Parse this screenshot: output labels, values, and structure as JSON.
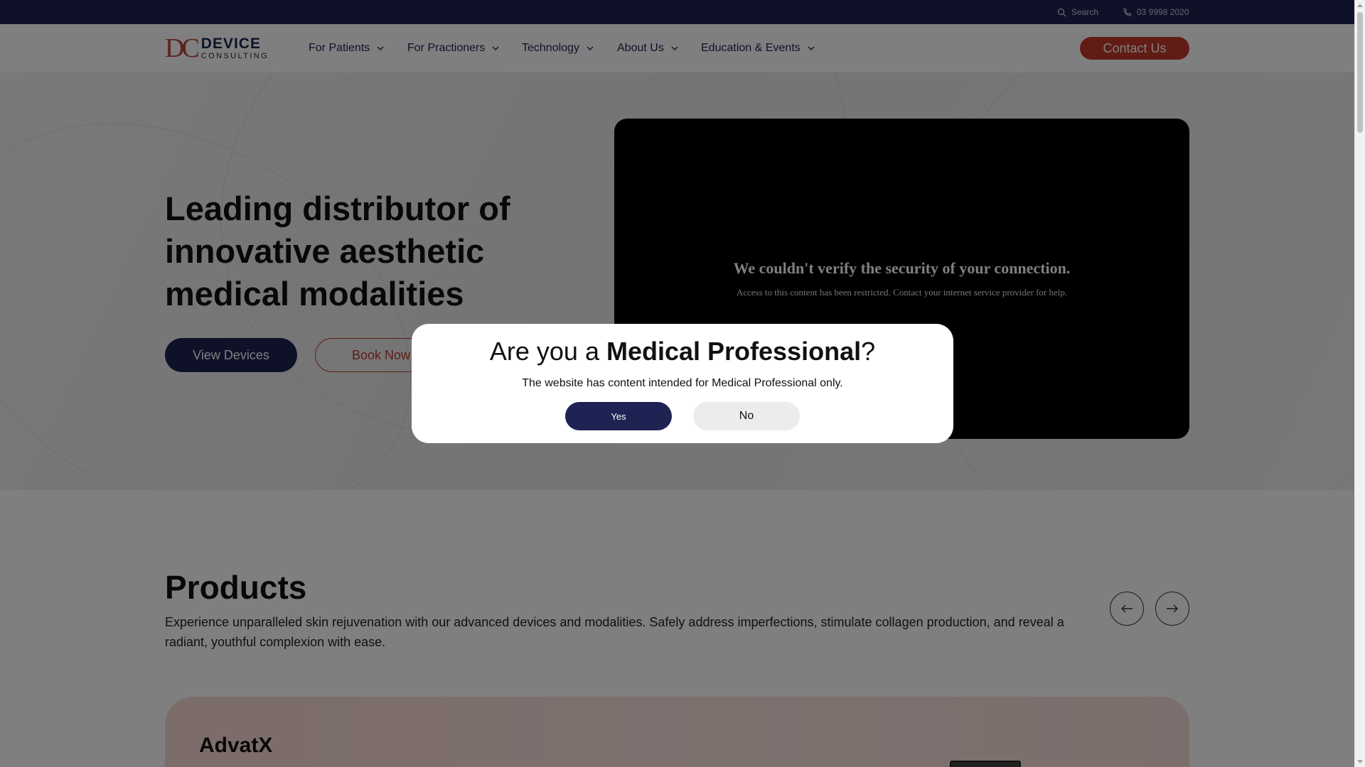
{
  "topbar": {
    "search_label": "Search",
    "search_icon": "search-icon",
    "phone_label": "03 9998 2020",
    "phone_icon": "phone-icon"
  },
  "logo": {
    "mark": "DC",
    "line1": "DEVICE",
    "line2": "CONSULTING"
  },
  "nav": {
    "items": [
      {
        "label": "For Patients"
      },
      {
        "label": "For Practioners"
      },
      {
        "label": "Technology"
      },
      {
        "label": "About Us"
      },
      {
        "label": "Education & Events"
      }
    ],
    "contact_label": "Contact Us"
  },
  "hero": {
    "title": "Leading distributor of innovative aesthetic medical modalities",
    "primary_button": "View Devices",
    "secondary_button": "Book Now",
    "video_error_title": "We couldn't verify the security of your connection.",
    "video_error_text": "Access to this content has been restricted. Contact your internet service provider for help."
  },
  "products": {
    "title": "Products",
    "description": "Experience unparalleled skin rejuvenation with our advanced devices and modalities. Safely address imperfections, stimulate collagen production, and reveal a radiant, youthful complexion with ease.",
    "card_title": "AdvatX"
  },
  "modal": {
    "title_prefix": "Are you a ",
    "title_bold": "Medical Professional",
    "title_suffix": "?",
    "text": "The website has content intended for Medical Professional only.",
    "yes_label": "Yes",
    "no_label": "No"
  },
  "colors": {
    "navy": "#1e2353",
    "accent_red": "#c0392b",
    "card_pink": "#f9d9d4"
  }
}
